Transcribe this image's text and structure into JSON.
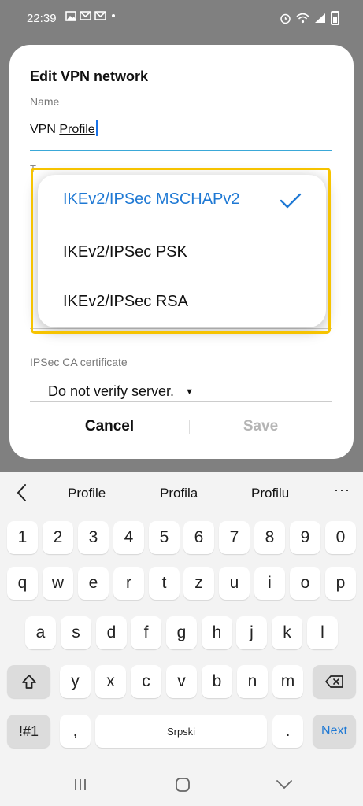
{
  "status_bar": {
    "time": "22:39",
    "icons_left": [
      "image-icon",
      "mail-icon",
      "mail-icon",
      "dot-icon"
    ],
    "icons_right": [
      "alarm-icon",
      "wifi-icon",
      "signal-icon",
      "battery-icon"
    ]
  },
  "dialog": {
    "title": "Edit VPN network",
    "name_label": "Name",
    "name_value_prefix": "VPN ",
    "name_value_underlined": "Profile",
    "type_label_partial": "T",
    "ca_label": "IPSec CA certificate",
    "ca_value": "Do not verify server.",
    "cancel_label": "Cancel",
    "save_label": "Save"
  },
  "type_dropdown": {
    "options": [
      {
        "label": "IKEv2/IPSec MSCHAPv2",
        "selected": true
      },
      {
        "label": "IKEv2/IPSec PSK",
        "selected": false
      },
      {
        "label": "IKEv2/IPSec RSA",
        "selected": false
      }
    ]
  },
  "keyboard": {
    "suggestions": [
      "Profile",
      "Profila",
      "Profilu"
    ],
    "more_label": "···",
    "row_numbers": [
      "1",
      "2",
      "3",
      "4",
      "5",
      "6",
      "7",
      "8",
      "9",
      "0"
    ],
    "row_1": [
      "q",
      "w",
      "e",
      "r",
      "t",
      "z",
      "u",
      "i",
      "o",
      "p"
    ],
    "row_2": [
      "a",
      "s",
      "d",
      "f",
      "g",
      "h",
      "j",
      "k",
      "l"
    ],
    "row_3": [
      "y",
      "x",
      "c",
      "v",
      "b",
      "n",
      "m"
    ],
    "symbols_label": "!#1",
    "comma_label": ",",
    "space_label": "Srpski",
    "period_label": ".",
    "next_label": "Next"
  },
  "colors": {
    "accent": "#1f79d4",
    "highlight": "#f6c300",
    "field_underline": "#3aa8d8"
  }
}
